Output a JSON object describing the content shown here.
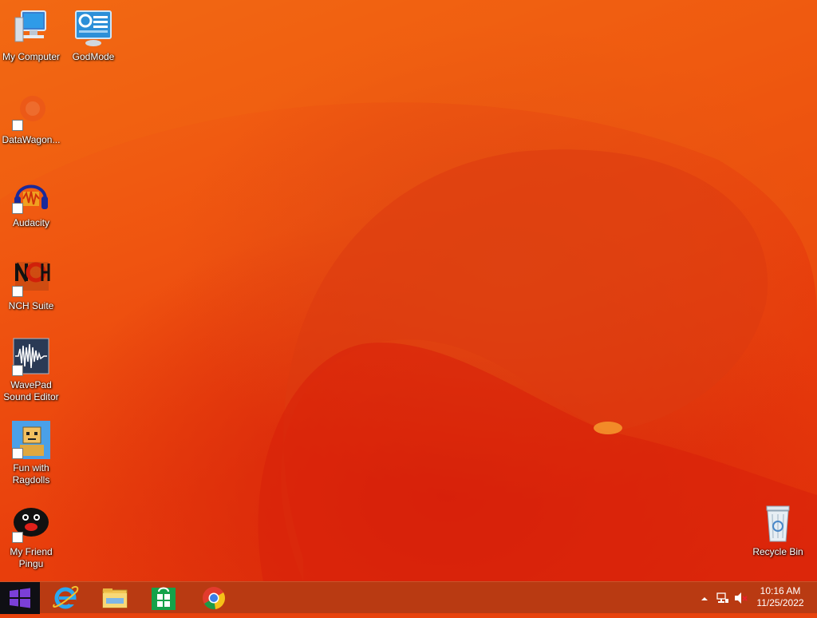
{
  "desktop": {
    "icons": [
      {
        "label": "My Computer",
        "icon": "computer-icon"
      },
      {
        "label": "GodMode",
        "icon": "control-panel-icon"
      },
      {
        "label": "DataWagon...",
        "icon": "datawagon-icon"
      },
      {
        "label": "Audacity",
        "icon": "audacity-icon"
      },
      {
        "label": "NCH Suite",
        "icon": "nch-icon"
      },
      {
        "label": "WavePad Sound Editor",
        "icon": "wavepad-icon"
      },
      {
        "label": "Fun with Ragdolls",
        "icon": "ragdoll-icon"
      },
      {
        "label": "My Friend Pingu",
        "icon": "pingu-icon"
      },
      {
        "label": "Recycle Bin",
        "icon": "recycle-bin-icon"
      }
    ]
  },
  "taskbar": {
    "pinned": [
      "internet-explorer-icon",
      "file-explorer-icon",
      "store-icon",
      "chrome-icon"
    ],
    "clock": {
      "time": "10:16 AM",
      "date": "11/25/2022"
    }
  },
  "colors": {
    "wallpaper": "#e8420c",
    "taskbar": "#b93a12",
    "start": "#0f0f14"
  }
}
